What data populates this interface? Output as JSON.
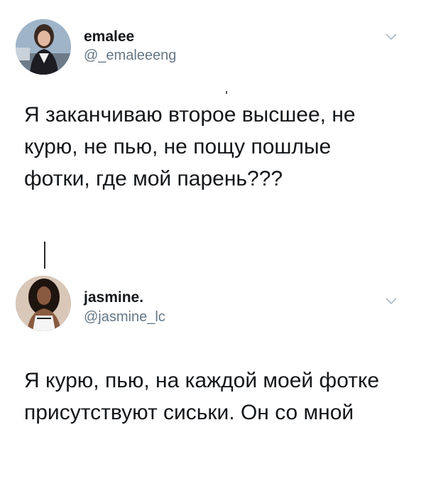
{
  "tweets": [
    {
      "name": "emalee",
      "handle": "@_emaleeeng",
      "text": "Я заканчиваю второе высшее, не курю, не пью, не пощу пошлые фотки, где мой парень???"
    },
    {
      "name": "jasmine.",
      "handle": "@jasmine_lc",
      "text": "Я курю, пью, на каждой моей фотке присутствуют сиськи. Он со мной"
    }
  ],
  "icons": {
    "more": "chevron-down-icon"
  },
  "colors": {
    "text": "#14171a",
    "secondary": "#657786",
    "chevron": "#aab8c2"
  }
}
